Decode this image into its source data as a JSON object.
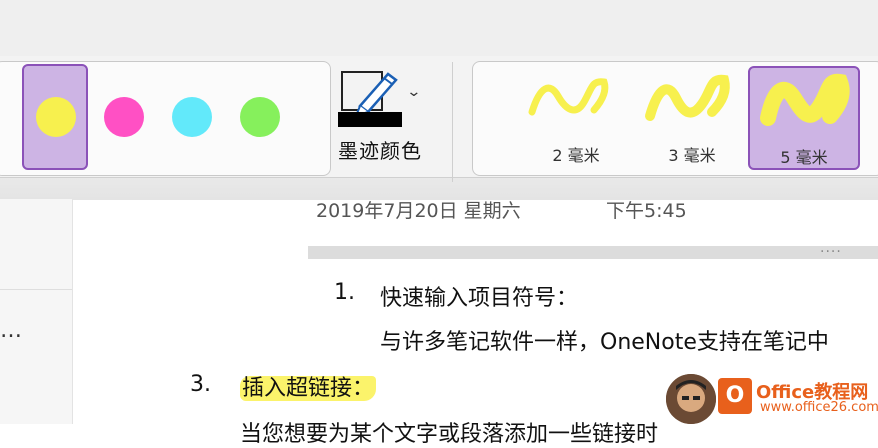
{
  "ribbon": {
    "colors": [
      {
        "name": "yellow",
        "hex": "#f7f04e",
        "selected": true
      },
      {
        "name": "pink",
        "hex": "#ff50c4",
        "selected": false
      },
      {
        "name": "cyan",
        "hex": "#62e9fa",
        "selected": false
      },
      {
        "name": "green",
        "hex": "#86f05c",
        "selected": false
      }
    ],
    "ink_color_label": "墨迹颜色",
    "ink_icon": "pen-icon",
    "sizes": [
      {
        "label": "2 毫米",
        "selected": false
      },
      {
        "label": "3 毫米",
        "selected": false
      },
      {
        "label": "5 毫米",
        "selected": true
      }
    ],
    "selection_color": "#cdb4e4",
    "selection_border": "#8b52b8"
  },
  "left_pane": {
    "ellipsis": "…"
  },
  "note": {
    "date": "2019年7月20日 星期六",
    "time": "下午5:45",
    "dots": "····",
    "items": [
      {
        "number": "1.",
        "text": "快速输入项目符号："
      },
      {
        "number": "",
        "text": "与许多笔记软件一样，OneNote支持在笔记中"
      },
      {
        "number": "3.",
        "text": "插入超链接："
      },
      {
        "number": "",
        "text": "当您想要为某个文字或段落添加一些链接时"
      }
    ],
    "highlight_color": "#fbf36b"
  },
  "watermark": {
    "title": "Office教程网",
    "url": "www.office26.com",
    "logo_icon": "office-logo-icon"
  }
}
